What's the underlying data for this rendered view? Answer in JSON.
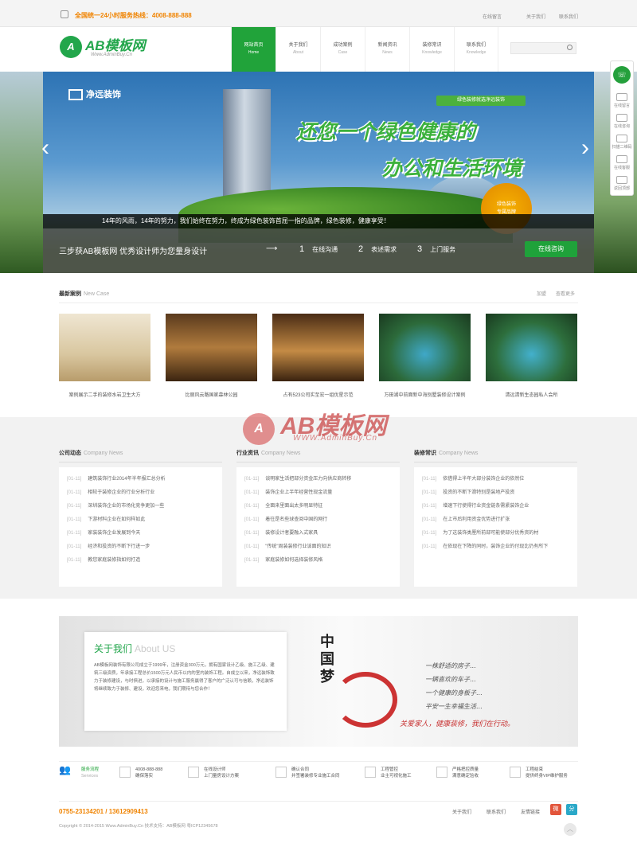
{
  "topbar": {
    "hotline_prefix": "全国统一24小时服务热线：",
    "hotline_number": "4008-888-888",
    "links": [
      "在线留言",
      "关于我们",
      "联系我们"
    ]
  },
  "logo": {
    "mark": "A",
    "name": "AB模板网",
    "sub": "Www.AdminBuy.Cn"
  },
  "nav": [
    {
      "cn": "网站首页",
      "en": "Home"
    },
    {
      "cn": "关于我们",
      "en": "About"
    },
    {
      "cn": "成功案例",
      "en": "Case"
    },
    {
      "cn": "新闻资讯",
      "en": "News"
    },
    {
      "cn": "装修常识",
      "en": "Knowledge"
    },
    {
      "cn": "联系我们",
      "en": "Knowledge"
    }
  ],
  "banner": {
    "brand": "净远装饰",
    "tag": "绿色装修就选净远装饰",
    "slogan1": "还您一个绿色健康的",
    "slogan2": "办公和生活环境",
    "badge_line1": "绿色装饰",
    "badge_line2": "专属品牌",
    "intro": "14年的风雨，14年的努力，我们始终在努力，终成为绿色装饰首屈一指的品牌，绿色装修，健康享受！",
    "steps_title": "三步获AB模板网 优秀设计师为您量身设计",
    "steps": [
      {
        "num": "1",
        "label": "在线沟通"
      },
      {
        "num": "2",
        "label": "表述需求"
      },
      {
        "num": "3",
        "label": "上门服务"
      }
    ],
    "consult_label": "在线咨询"
  },
  "floatbar": {
    "items": [
      "在线留言",
      "在线咨询",
      "扫描二维码",
      "在线客服",
      "返回顶部"
    ]
  },
  "cases": {
    "title": "最新案例",
    "title_en": "New Case",
    "more1": "加盟",
    "more2": "查看更多",
    "items": [
      {
        "caption": "案例展示二手的装修水岩卫生大方"
      },
      {
        "caption": "比丽风云路国家森林公园"
      },
      {
        "caption": "占有523公司实至宏一组优星示范"
      },
      {
        "caption": "万田湖中前面新中海别墅装修设计案例"
      },
      {
        "caption": "清远清新生态园私人会所"
      }
    ]
  },
  "watermark": {
    "mark": "A",
    "text": "AB模板网",
    "sub": "WWW.AdminBuy.Cn"
  },
  "news": [
    {
      "title": "公司动态",
      "title_en": "Company News",
      "items": [
        {
          "date": "[01-11]",
          "text": "建筑装饰行业2014年半年报汇总分析"
        },
        {
          "date": "[01-11]",
          "text": "相较于装修企业的行业分析行业"
        },
        {
          "date": "[01-11]",
          "text": "深圳装饰企业的市场化竞争更加一些"
        },
        {
          "date": "[01-11]",
          "text": "下游材料企业在如何样如此"
        },
        {
          "date": "[01-11]",
          "text": "家装装饰企业发展到今天"
        },
        {
          "date": "[01-11]",
          "text": "经济和投资的不断下行进一步"
        },
        {
          "date": "[01-11]",
          "text": "教您家庭装修指如何打造"
        }
      ]
    },
    {
      "title": "行业资讯",
      "title_en": "Company News",
      "items": [
        {
          "date": "[01-11]",
          "text": "谈明家生活把部分资金压力向供应商转移"
        },
        {
          "date": "[01-11]",
          "text": "装饰企业上半年经营性现金流量"
        },
        {
          "date": "[01-11]",
          "text": "全面来里面出太多明显特征"
        },
        {
          "date": "[01-11]",
          "text": "着往是名些球查阅中国的网行"
        },
        {
          "date": "[01-11]",
          "text": "装修设计者要融入式家具"
        },
        {
          "date": "[01-11]",
          "text": "\"传统\"周装装修行业该面的知识"
        },
        {
          "date": "[01-11]",
          "text": "家庭装修如何选择装修风格"
        }
      ]
    },
    {
      "title": "装修常识",
      "title_en": "Company News",
      "items": [
        {
          "date": "[01-11]",
          "text": "依借得上半年大部分装饰企业的依然位"
        },
        {
          "date": "[01-11]",
          "text": "投资的不断下滑特别是装地产投资"
        },
        {
          "date": "[01-11]",
          "text": "增速下行使得行业资金链条需紧装饰企业"
        },
        {
          "date": "[01-11]",
          "text": "在上市后利用资金优势进行扩张"
        },
        {
          "date": "[01-11]",
          "text": "为了这装饰类厘所前部可能使部分优秀资的材"
        },
        {
          "date": "[01-11]",
          "text": "在依现在下降的同时，装饰企业的付现比仍有所下"
        }
      ]
    }
  ],
  "about": {
    "title": "关于我们",
    "title_en": "About US",
    "text": "AB模板网装饰有限公司成立于1999年，注册资金300万元，拥有国家设计乙级、施工乙级、建筑三级资质，年承接工程总价1500万元人民币以内的室内装饰工程。自成立以来，净远装饰致力于装修建设，与时俱进，以承接的设计与施工服务赢得了客户的广泛认可与信赖，净远装饰将继续致力于装修、建设，欢迎您来电，我们期待与您合作！",
    "china_text": "中国梦",
    "poem": [
      "一株舒适的房子...",
      "一辆喜欢的车子...",
      "一个健康的身板子...",
      "平安一生幸福生活..."
    ],
    "poem_red": "关爱家人，健康装修，我们在行动。"
  },
  "services": [
    {
      "l1": "服务流程",
      "l2": "Services"
    },
    {
      "l1": "4008-888-888",
      "l2": "确保落实"
    },
    {
      "l1": "在线设计师",
      "l2": "上门量房设计方案"
    },
    {
      "l1": "确认合同",
      "l2": "并签署装修专业施工合同"
    },
    {
      "l1": "工程管控",
      "l2": "业主可视化施工"
    },
    {
      "l1": "严格把控质量",
      "l2": "满意确定验收"
    },
    {
      "l1": "工程结束",
      "l2": "提供终身VIP维护服务"
    }
  ],
  "footer": {
    "phone": "0755-23134201 / 13612909413",
    "copyright": "Copyright © 2014-2015 Www.AdminBuy.Cn 技术支持：AB模板网 粤ICP12345678",
    "links": [
      "关于我们",
      "联系我们",
      "友情链接"
    ],
    "weibo": "微",
    "share": "分"
  },
  "colors": {
    "brand_green": "#21a33a",
    "accent_orange": "#f08300"
  }
}
